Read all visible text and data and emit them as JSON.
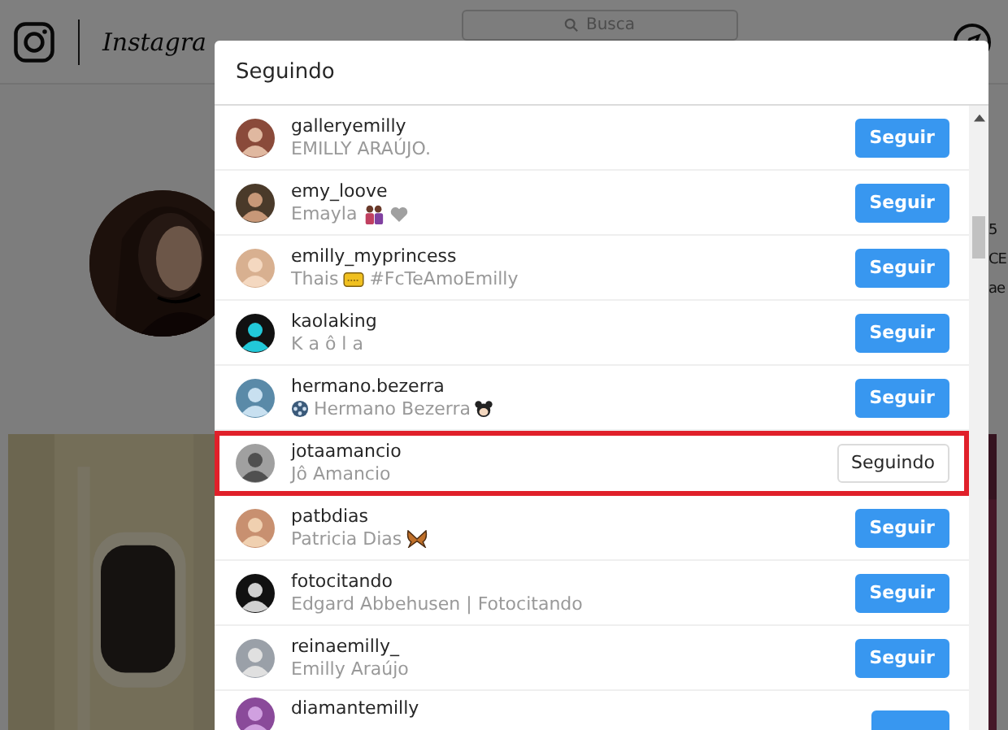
{
  "header": {
    "logo_text": "Instagra",
    "search": {
      "placeholder": "Busca"
    }
  },
  "profile": {
    "fragments": [
      "5",
      "CE",
      "ae"
    ]
  },
  "modal": {
    "title": "Seguindo",
    "users": [
      {
        "username": "galleryemilly",
        "name": "EMILLY ARAÚJO.",
        "following": false,
        "highlighted": false,
        "button": "Seguir"
      },
      {
        "username": "emy_loove",
        "name": "Emayla",
        "following": false,
        "highlighted": false,
        "button": "Seguir"
      },
      {
        "username": "emilly_myprincess",
        "name": "Thais",
        "tail": "#FcTeAmoEmilly",
        "following": false,
        "highlighted": false,
        "button": "Seguir"
      },
      {
        "username": "kaolaking",
        "name": "K a ô l a",
        "following": false,
        "highlighted": false,
        "button": "Seguir"
      },
      {
        "username": "hermano.bezerra",
        "name": "Hermano Bezerra",
        "following": false,
        "highlighted": false,
        "button": "Seguir"
      },
      {
        "username": "jotaamancio",
        "name": "Jô Amancio",
        "following": true,
        "highlighted": true,
        "button": "Seguindo"
      },
      {
        "username": "patbdias",
        "name": "Patricia Dias",
        "following": false,
        "highlighted": false,
        "button": "Seguir"
      },
      {
        "username": "fotocitando",
        "name": "Edgard Abbehusen | Fotocitando",
        "following": false,
        "highlighted": false,
        "button": "Seguir"
      },
      {
        "username": "reinaemilly_",
        "name": "Emilly Araújo",
        "following": false,
        "highlighted": false,
        "button": "Seguir"
      },
      {
        "username": "diamantemilly",
        "following": false,
        "highlighted": false
      }
    ]
  }
}
